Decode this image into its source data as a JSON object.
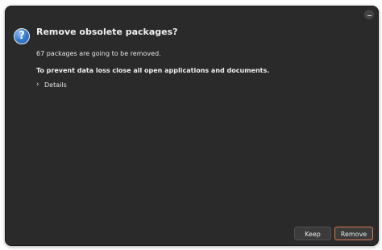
{
  "dialog": {
    "title": "Remove obsolete packages?",
    "summary": "67 packages are going to be removed.",
    "warning": "To prevent data loss close all open applications and documents.",
    "details_label": "Details",
    "details_icon": "chevron-right-icon",
    "main_icon": "question-icon",
    "question_mark": "?"
  },
  "window": {
    "minimize_icon": "minimize-icon"
  },
  "buttons": {
    "keep": "Keep",
    "remove": "Remove"
  },
  "colors": {
    "background": "#2a2a2a",
    "accent": "#e07a50",
    "icon_blue": "#3f7fd0"
  }
}
